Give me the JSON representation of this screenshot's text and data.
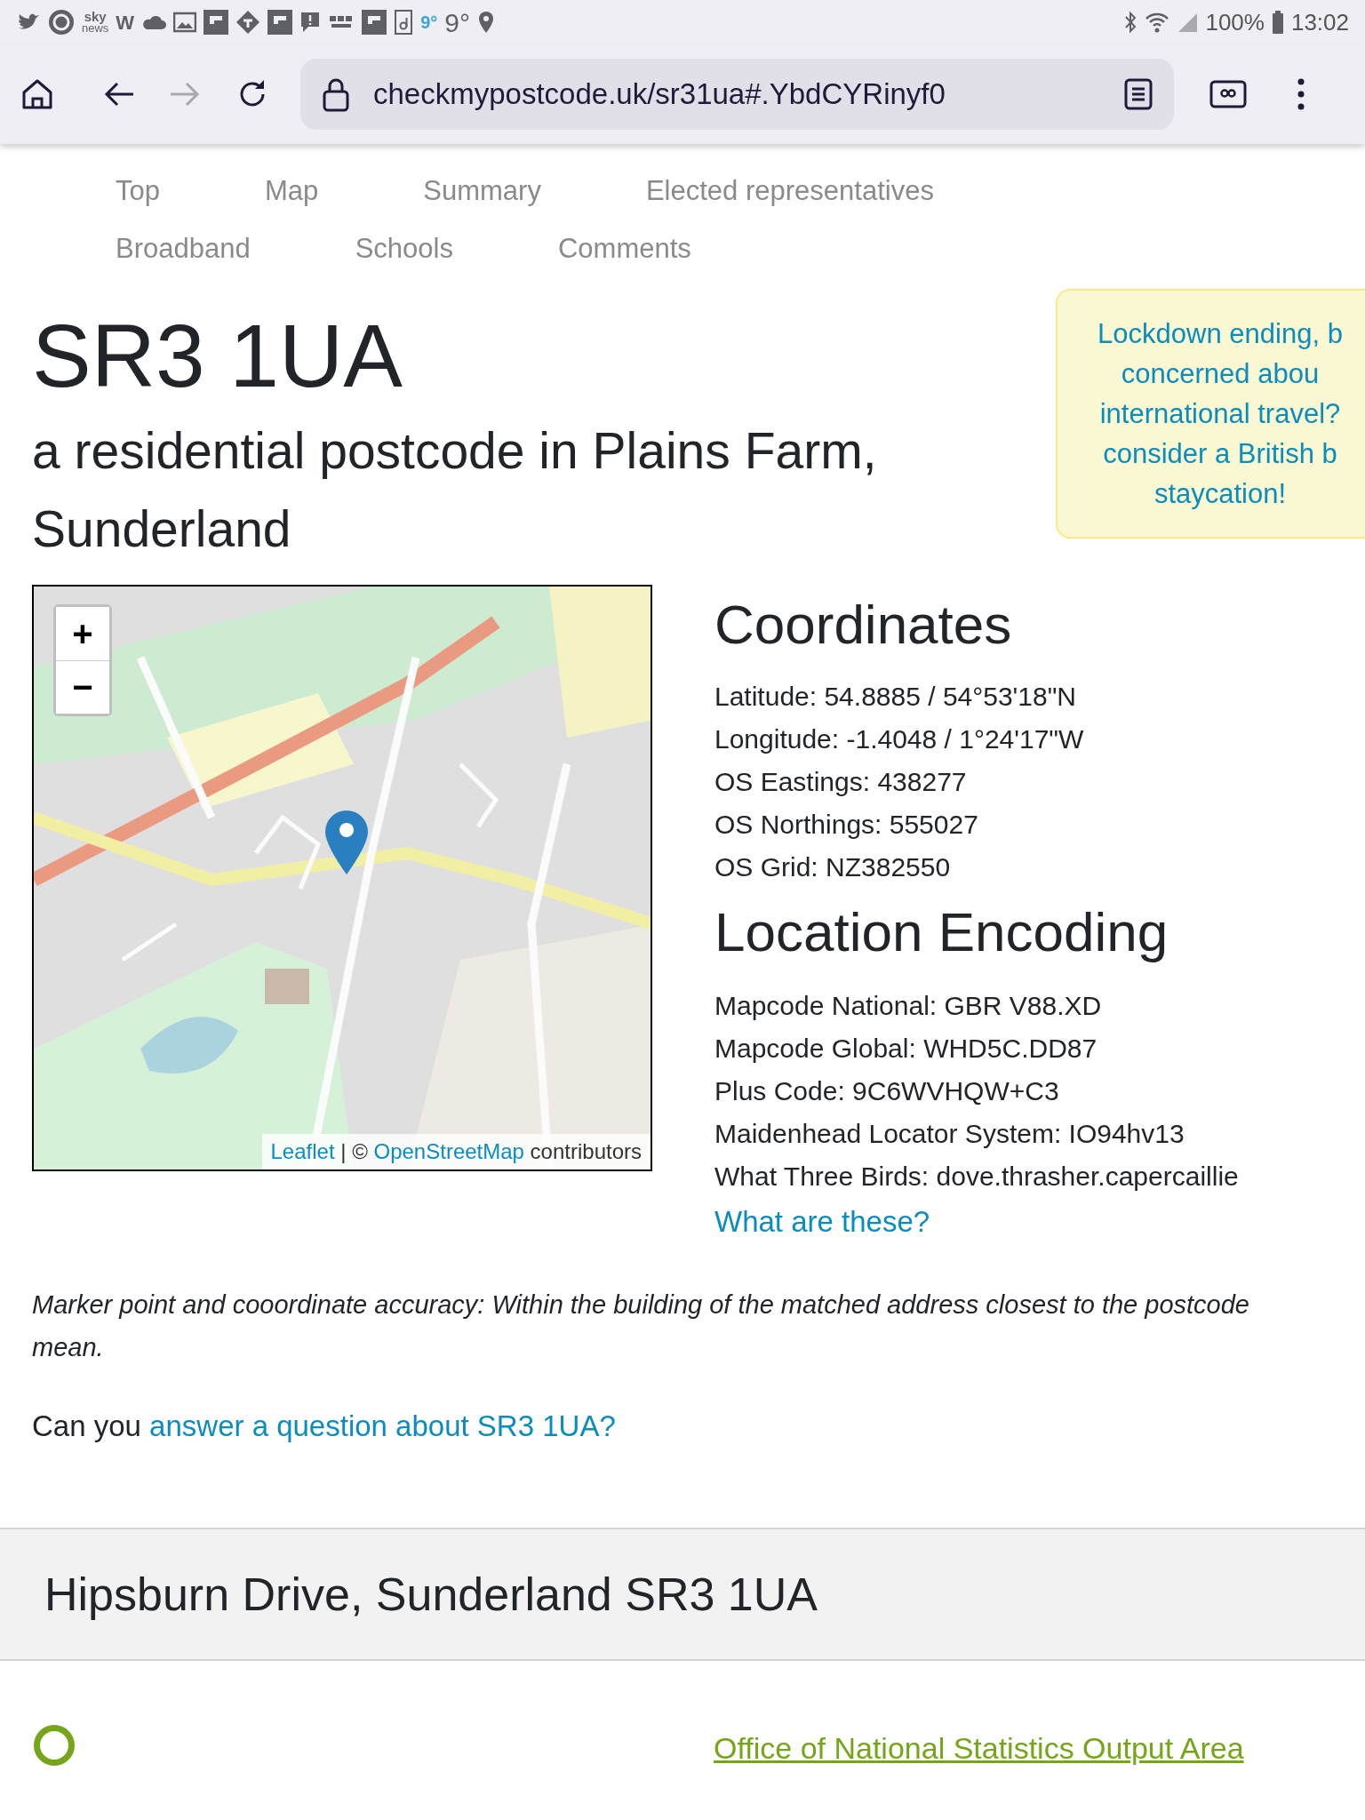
{
  "status_bar": {
    "sky_news": [
      "sky",
      "news"
    ],
    "w_label": "W",
    "weather": [
      "9°",
      "9°"
    ],
    "battery": "100%",
    "time": "13:02"
  },
  "browser": {
    "url": "checkmypostcode.uk/sr31ua#.YbdCYRinyf0",
    "back_disabled": false,
    "forward_disabled": true
  },
  "nav": [
    {
      "label": "Top"
    },
    {
      "label": "Map"
    },
    {
      "label": "Summary"
    },
    {
      "label": "Elected representatives"
    },
    {
      "label": "Broadband"
    },
    {
      "label": "Schools"
    },
    {
      "label": "Comments"
    }
  ],
  "postcode": "SR3 1UA",
  "subtitle": "a residential postcode in Plains Farm, Sunderland",
  "promo": {
    "lines": [
      "Lockdown ending, b",
      "concerned abou",
      "international travel?",
      "consider a British b",
      "staycation!"
    ]
  },
  "map": {
    "kind": "picture",
    "zoom_in": "+",
    "zoom_out": "−",
    "attribution": {
      "link1": "Leaflet",
      "separator": "|",
      "copyright": "©",
      "link2": "OpenStreetMap",
      "suffix": "contributors"
    }
  },
  "coordinates": {
    "title": "Coordinates",
    "rows": [
      "Latitude: 54.8885 / 54°53'18\"N",
      "Longitude: -1.4048 / 1°24'17\"W",
      "OS Eastings: 438277",
      "OS Northings: 555027",
      "OS Grid: NZ382550"
    ]
  },
  "location_encoding": {
    "title": "Location Encoding",
    "rows": [
      "Mapcode National: GBR V88.XD",
      "Mapcode Global: WHD5C.DD87",
      "Plus Code: 9C6WVHQW+C3",
      "Maidenhead Locator System: IO94hv13",
      "What Three Birds: dove.thrasher.capercaillie"
    ],
    "help_link": "What are these?"
  },
  "accuracy_note": "Marker point and cooordinate accuracy: Within the building of the matched address closest to the postcode mean.",
  "question": {
    "prefix": "Can you",
    "link": "answer a question about SR3 1UA?"
  },
  "address_heading": "Hipsburn Drive, Sunderland SR3 1UA",
  "next_section": {
    "heading": "Office of National Statistics Output Area"
  }
}
